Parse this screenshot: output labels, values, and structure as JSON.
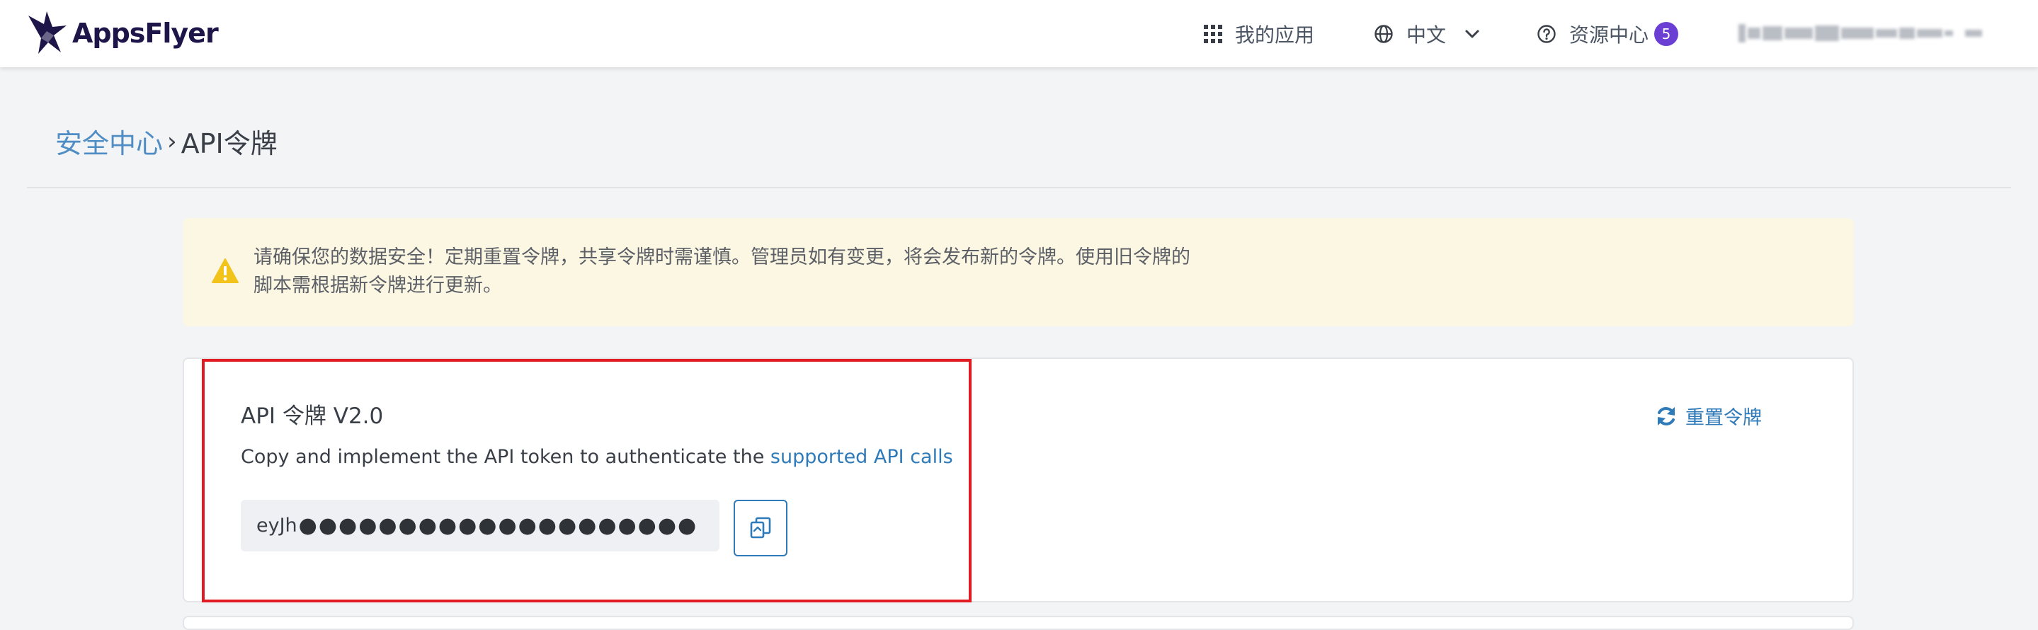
{
  "header": {
    "brand": "AppsFlyer",
    "nav": {
      "my_apps": "我的应用",
      "language": "中文",
      "resource_center": "资源中心",
      "resource_badge": "5"
    }
  },
  "breadcrumb": {
    "parent": "安全中心",
    "separator": "›",
    "current": "API令牌"
  },
  "warning": {
    "line1": "请确保您的数据安全！定期重置令牌，共享令牌时需谨慎。管理员如有变更，将会发布新的令牌。使用旧令牌的",
    "line2": "脚本需根据新令牌进行更新。"
  },
  "token_card": {
    "title": "API 令牌 V2.0",
    "description": "Copy and implement the API token to authenticate the ",
    "link_text": "supported API calls",
    "token_prefix": "eyJh",
    "token_mask": "●●●●●●●●●●●●●●●●●●●●",
    "reset_label": "重置令牌"
  },
  "colors": {
    "accent": "#2f7ab8",
    "badge": "#6b3fd4",
    "highlight": "#e21b22",
    "warning_bg": "#fcf7e3",
    "warning_icon": "#f2c31b"
  }
}
